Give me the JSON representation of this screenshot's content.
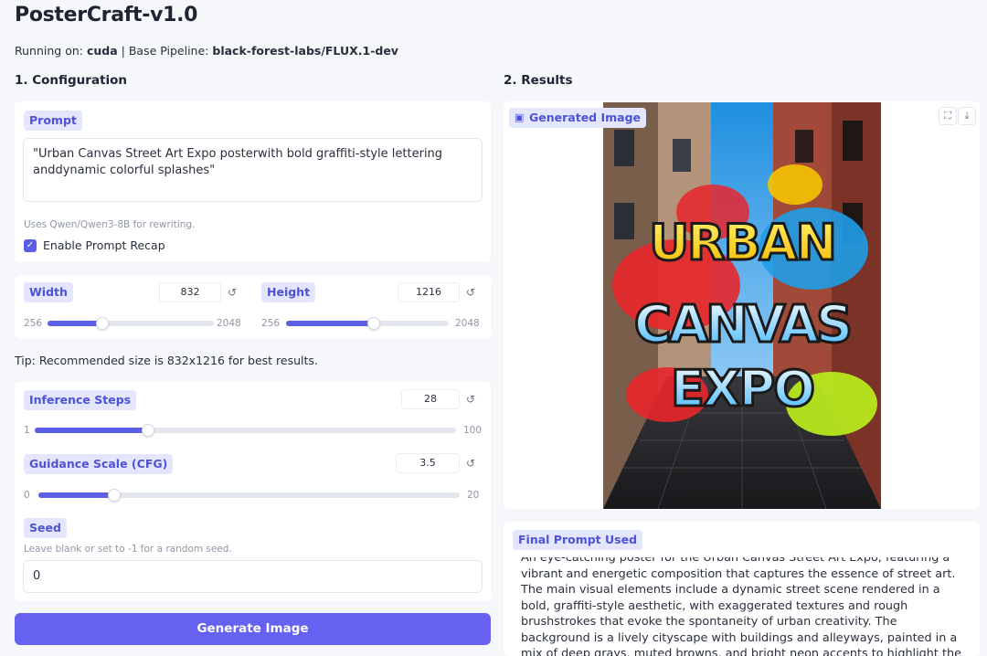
{
  "app": {
    "title": "PosterCraft-v1.0",
    "running_prefix": "Running on:",
    "device": "cuda",
    "pipeline_prefix": "| Base Pipeline:",
    "pipeline": "black-forest-labs/FLUX.1-dev"
  },
  "config": {
    "section_title": "1. Configuration",
    "prompt": {
      "label": "Prompt",
      "value": "\"Urban Canvas Street Art Expo posterwith bold graffiti-style lettering anddynamic colorful splashes\"",
      "hint": "Uses Qwen/Qwen3-8B for rewriting.",
      "recap_label": "Enable Prompt Recap",
      "recap_checked": true
    },
    "width": {
      "label": "Width",
      "value": "832",
      "min": "256",
      "max": "2048",
      "level": 0.33
    },
    "height": {
      "label": "Height",
      "value": "1216",
      "min": "256",
      "max": "2048",
      "level": 0.54
    },
    "tip": "Tip: Recommended size is 832x1216 for best results.",
    "steps": {
      "label": "Inference Steps",
      "value": "28",
      "min": "1",
      "max": "100",
      "level": 0.27
    },
    "cfg": {
      "label": "Guidance Scale (CFG)",
      "value": "3.5",
      "min": "0",
      "max": "20",
      "level": 0.18
    },
    "seed": {
      "label": "Seed",
      "hint": "Leave blank or set to -1 for a random seed.",
      "value": "0"
    },
    "generate_label": "Generate Image",
    "reset_glyph": "↺",
    "check_glyph": "✓"
  },
  "results": {
    "section_title": "2. Results",
    "image_label": "Generated Image",
    "image_icon": "image-icon",
    "fullscreen_icon": "fullscreen-icon",
    "download_icon": "download-icon",
    "poster_text": [
      "URBAN",
      "CANVAS",
      "EXPO"
    ],
    "final_prompt_label": "Final Prompt Used",
    "final_prompt": "An eye-catching poster for the Urban Canvas Street Art Expo, featuring a vibrant and energetic composition that captures the essence of street art. The main visual elements include a dynamic street scene rendered in a bold, graffiti-style aesthetic, with exaggerated textures and rough brushstrokes that evoke the spontaneity of urban creativity. The background is a lively cityscape with buildings and alleyways, painted in a mix of deep grays, muted browns, and bright neon accents to highlight the contrast between the"
  },
  "colors": {
    "accent": "#5b5fe6",
    "pill_bg": "#e3e6fc",
    "pill_text": "#4d52d8",
    "button": "#6661f0"
  }
}
